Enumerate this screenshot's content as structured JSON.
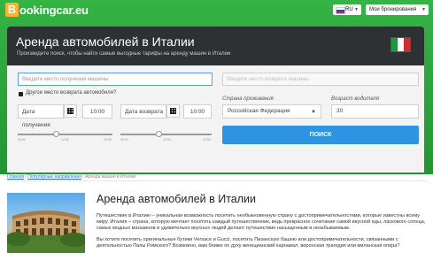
{
  "header": {
    "logo_letter": "B",
    "logo_text": "ookingcar.eu",
    "language": "RU",
    "bookings_label": "Мои бронирования"
  },
  "hero": {
    "title": "Аренда автомобилей в Италии",
    "subtitle": "Произведите поиск, чтобы найти самые выгодные тарифы на аренду машин в Италии"
  },
  "form": {
    "pickup_placeholder": "Введите место получения машины",
    "dropoff_placeholder": "Введите место возврата машины",
    "other_return_label": "Другое место возврата автомобиля?",
    "pickup_date_label": "Дата получения",
    "pickup_time": "10:00",
    "return_date_label": "Дата возврата",
    "return_time": "10:00",
    "slider1_ticks": [
      "00:00",
      "12:00",
      "23:59"
    ],
    "slider2_ticks": [
      "00:00",
      "12:00",
      "23:59"
    ],
    "country_label": "Страна проживания",
    "country_value": "Российская Федерация",
    "age_label": "Возраст водителя",
    "age_value": "30",
    "search_button": "ПОИСК"
  },
  "breadcrumb": {
    "home": "Главная",
    "popular": "Популярные направления",
    "current": "Аренда машин в Италии"
  },
  "article": {
    "title": "Аренда автомобилей в Италии",
    "paragraph1": "Путешествие в Италию – уникальная возможность посетить необыкновенную страну с достопримечательностями, которые известны всему миру. Италия – страна, которую мечтает посетить каждый путешественник, ведь прекрасное сочетание самой вкусной еды, ласкового солнца, самых модных магазинов и удивительно вкусных людей делают путешествие насыщенным и незабываемым.",
    "paragraph2": "Вы хотите посетить оригинальные бутики Versace и Gucci, посетить Пизанскую башню или достопримечательности, связанными с деятельностью Папы Римского? Возможно, вам ближе по духу венецианский карнавал, веронская трагедия или миланская опера?"
  },
  "colors": {
    "green": "#2aa83a",
    "panel": "#2e3134",
    "accent": "#2e93e3"
  }
}
